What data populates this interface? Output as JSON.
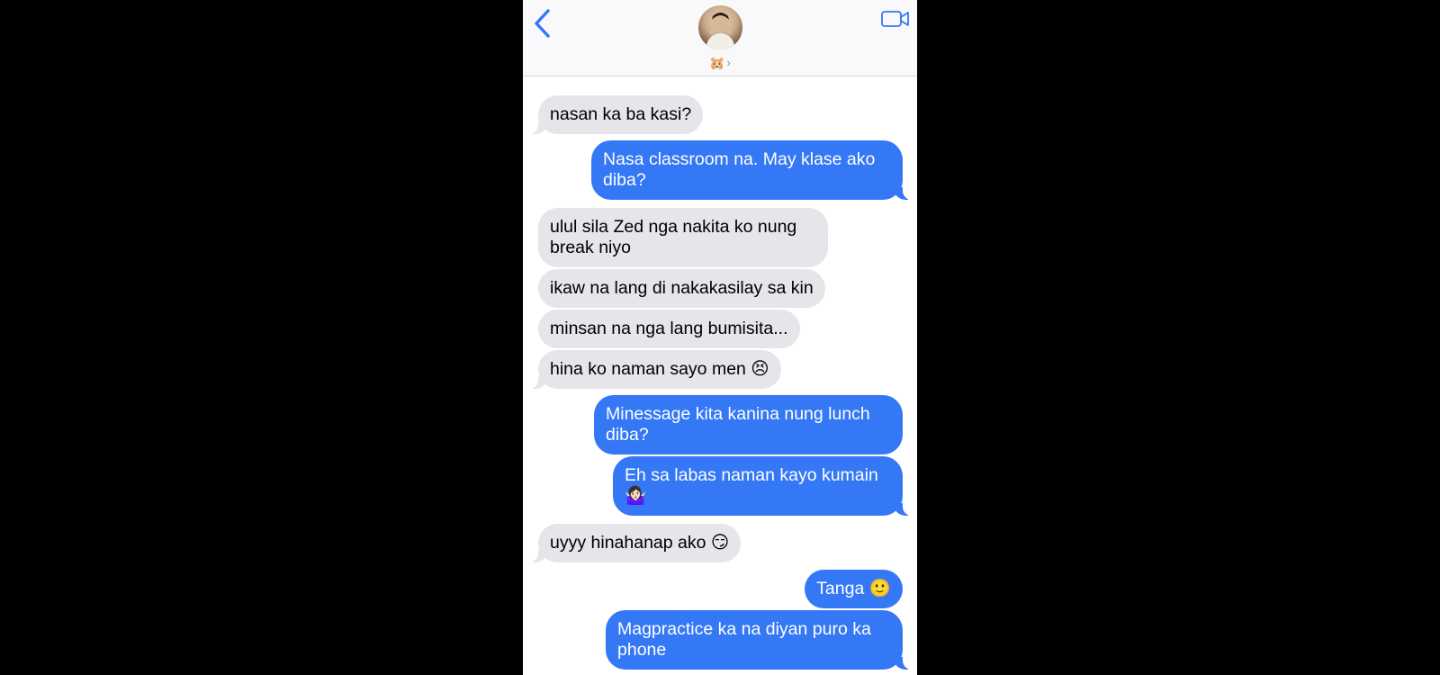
{
  "header": {
    "contact_emoji": "🐹",
    "chevron": "›",
    "icons": {
      "back": "chevron-left-icon",
      "video": "video-camera-icon"
    },
    "accent_color": "#3478f6"
  },
  "messages": [
    {
      "direction": "in",
      "text": "nasan ka ba kasi?"
    },
    {
      "direction": "out",
      "text": "Nasa classroom na. May klase ako diba?"
    },
    {
      "direction": "in",
      "text": "ulul sila Zed nga nakita ko nung break niyo"
    },
    {
      "direction": "in",
      "text": "ikaw na lang di nakakasilay sa kin"
    },
    {
      "direction": "in",
      "text": "minsan na nga lang bumisita..."
    },
    {
      "direction": "in",
      "text": "hina ko naman sayo men 😣"
    },
    {
      "direction": "out",
      "text": "Minessage kita kanina nung lunch diba?"
    },
    {
      "direction": "out",
      "text": "Eh sa labas naman kayo kumain 🤷🏻‍♀️"
    },
    {
      "direction": "in",
      "text": "uyyy hinahanap ako 😏"
    },
    {
      "direction": "out",
      "text": "Tanga 🙂"
    },
    {
      "direction": "out",
      "text": "Magpractice ka na diyan puro ka phone"
    }
  ],
  "colors": {
    "incoming_bubble": "#e5e5ea",
    "outgoing_bubble": "#3478f6"
  }
}
